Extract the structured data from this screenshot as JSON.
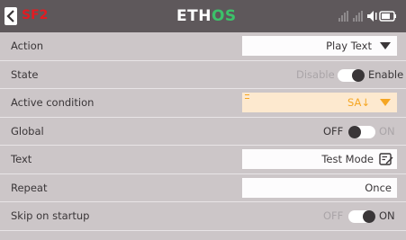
{
  "header": {
    "title": "SF2",
    "logo_left": "ETH",
    "logo_right": "OS",
    "title_color": "#e21b22",
    "logo_accent": "#3cc26a"
  },
  "rows": {
    "action": {
      "label": "Action",
      "value": "Play Text",
      "icon": "dropdown-caret-icon"
    },
    "state": {
      "label": "State",
      "off_label": "Disable",
      "on_label": "Enable",
      "checked": true
    },
    "active_condition": {
      "label": "Active condition",
      "value": "SA↓",
      "icon": "dropdown-caret-icon"
    },
    "global": {
      "label": "Global",
      "off_label": "OFF",
      "on_label": "ON",
      "checked": false
    },
    "text": {
      "label": "Text",
      "value": "Test Mode",
      "icon": "edit-text-icon"
    },
    "repeat": {
      "label": "Repeat",
      "value": "Once"
    },
    "skip_on_startup": {
      "label": "Skip on startup",
      "off_label": "OFF",
      "on_label": "ON",
      "checked": true
    }
  },
  "colors": {
    "header_bg": "#5e585b",
    "page_bg": "#ccc6c8",
    "accent_orange": "#f5a623"
  },
  "status_icons": [
    "signal-bars-icon",
    "signal-bars-icon",
    "speaker-icon",
    "battery-icon"
  ]
}
